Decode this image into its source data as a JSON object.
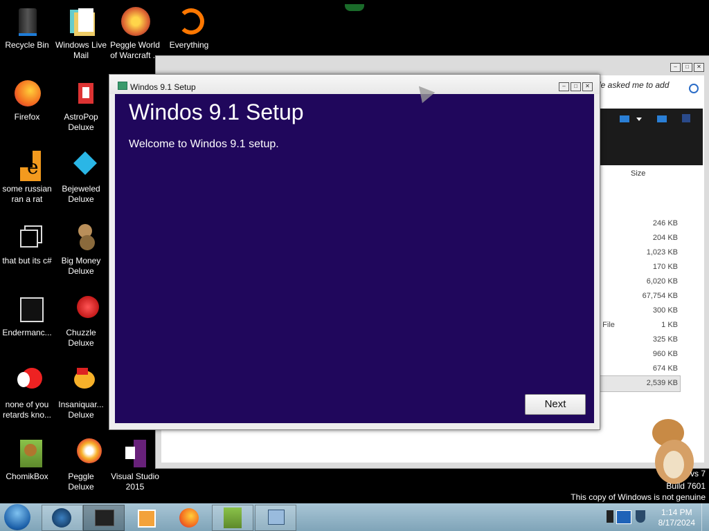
{
  "desktop_icons": [
    {
      "label": "Recycle Bin",
      "icon": "recycle-bin-icon"
    },
    {
      "label": "Windows Live Mail",
      "icon": "windows-live-mail-icon"
    },
    {
      "label": "Peggle World of Warcraft ...",
      "icon": "peggle-wow-icon"
    },
    {
      "label": "Everything",
      "icon": "everything-search-icon"
    },
    {
      "label": "Firefox",
      "icon": "firefox-icon"
    },
    {
      "label": "AstroPop Deluxe",
      "icon": "astropop-icon"
    },
    {
      "label": "some russian ran a rat",
      "icon": "file-e-icon"
    },
    {
      "label": "Bejeweled Deluxe",
      "icon": "bejeweled-icon"
    },
    {
      "label": "that but its c#",
      "icon": "copy-windows-icon"
    },
    {
      "label": "Big Money Deluxe",
      "icon": "big-money-icon"
    },
    {
      "label": "Endermanc...",
      "icon": "endermanch-icon"
    },
    {
      "label": "Chuzzle Deluxe",
      "icon": "chuzzle-icon"
    },
    {
      "label": "none of you retards kno...",
      "icon": "bird-icon"
    },
    {
      "label": "Insaniquar... Deluxe",
      "icon": "insaniquarium-icon"
    },
    {
      "label": "ChomikBox",
      "icon": "chomikbox-icon"
    },
    {
      "label": "Peggle Deluxe",
      "icon": "peggle-icon"
    },
    {
      "label": "Visual Studio 2015",
      "icon": "visual-studio-icon"
    }
  ],
  "explorer": {
    "search_placeholder": "le asked me to add",
    "size_header": "Size",
    "sizes": [
      "246 KB",
      "204 KB",
      "1,023 KB",
      "170 KB",
      "6,020 KB",
      "67,754 KB",
      "300 KB",
      "1 KB",
      "325 KB",
      "960 KB",
      "674 KB",
      "2,539 KB"
    ],
    "type_fragment": "h File"
  },
  "setup": {
    "window_title": "Windos 9.1 Setup",
    "heading": "Windos 9.1 Setup",
    "welcome": "Welcome to Windos 9.1 setup.",
    "next_label": "Next"
  },
  "watermark": {
    "line1": "vs 7",
    "line2": "Build 7601",
    "line3": "This copy of Windows is not genuine"
  },
  "taskbar": {
    "time": "1:14 PM",
    "date": "8/17/2024",
    "items": [
      "start-orb-icon",
      "globe-icon",
      "app-window-icon",
      "media-player-icon",
      "firefox-icon",
      "chomikbox-icon",
      "setup-icon"
    ]
  },
  "colors": {
    "setup_bg": "#20075c",
    "taskbar": "#8fb3c6"
  }
}
